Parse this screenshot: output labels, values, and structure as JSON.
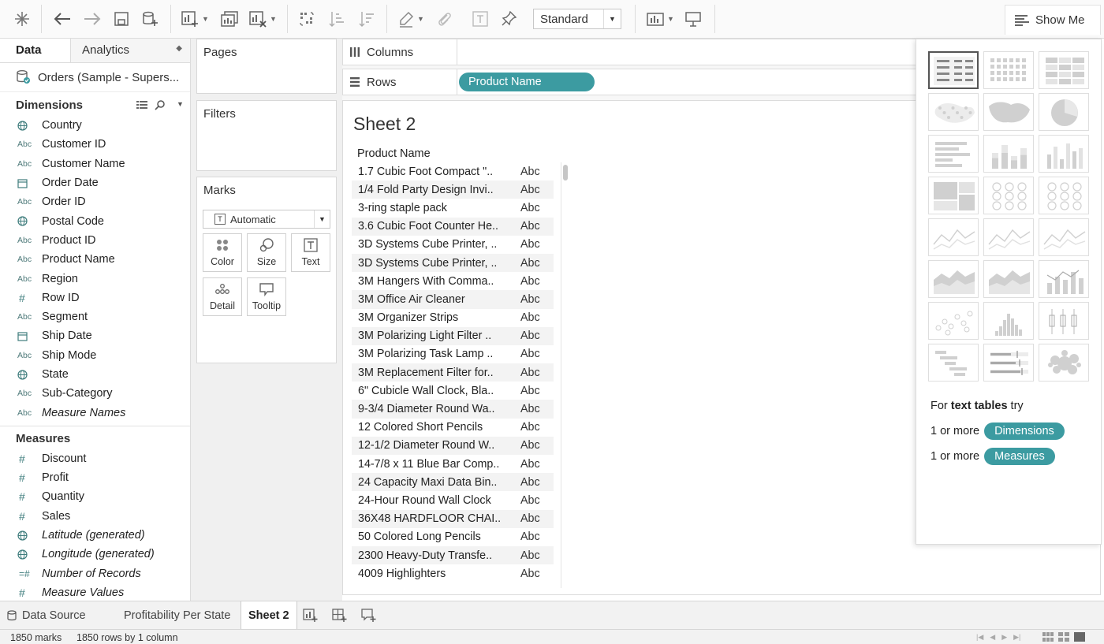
{
  "toolbar": {
    "fit_label": "Standard",
    "show_me_label": "Show Me"
  },
  "data_pane": {
    "tab_data": "Data",
    "tab_analytics": "Analytics",
    "datasource": "Orders (Sample - Supers...",
    "dimensions_header": "Dimensions",
    "dimensions": [
      {
        "icon": "globe",
        "name": "Country"
      },
      {
        "icon": "Abc",
        "name": "Customer ID"
      },
      {
        "icon": "Abc",
        "name": "Customer Name"
      },
      {
        "icon": "calendar",
        "name": "Order Date"
      },
      {
        "icon": "Abc",
        "name": "Order ID"
      },
      {
        "icon": "globe",
        "name": "Postal Code"
      },
      {
        "icon": "Abc",
        "name": "Product ID"
      },
      {
        "icon": "Abc",
        "name": "Product Name"
      },
      {
        "icon": "Abc",
        "name": "Region"
      },
      {
        "icon": "#",
        "name": "Row ID"
      },
      {
        "icon": "Abc",
        "name": "Segment"
      },
      {
        "icon": "calendar",
        "name": "Ship Date"
      },
      {
        "icon": "Abc",
        "name": "Ship Mode"
      },
      {
        "icon": "globe",
        "name": "State"
      },
      {
        "icon": "Abc",
        "name": "Sub-Category"
      },
      {
        "icon": "Abc",
        "name": "Measure Names"
      }
    ],
    "measures_header": "Measures",
    "measures": [
      {
        "icon": "#",
        "name": "Discount"
      },
      {
        "icon": "#",
        "name": "Profit"
      },
      {
        "icon": "#",
        "name": "Quantity"
      },
      {
        "icon": "#",
        "name": "Sales"
      },
      {
        "icon": "globe",
        "name": "Latitude (generated)"
      },
      {
        "icon": "globe",
        "name": "Longitude (generated)"
      },
      {
        "icon": "=#",
        "name": "Number of Records"
      },
      {
        "icon": "#",
        "name": "Measure Values"
      }
    ]
  },
  "cards": {
    "pages": "Pages",
    "filters": "Filters",
    "marks": "Marks",
    "marks_type": "Automatic",
    "buttons": [
      "Color",
      "Size",
      "Text",
      "Detail",
      "Tooltip"
    ]
  },
  "shelves": {
    "columns": "Columns",
    "rows": "Rows",
    "rows_pill": "Product Name"
  },
  "sheet": {
    "title": "Sheet 2",
    "column_header": "Product Name",
    "rows": [
      {
        "name": "1.7 Cubic Foot Compact \"..",
        "value": "Abc"
      },
      {
        "name": "1/4 Fold Party Design Invi..",
        "value": "Abc"
      },
      {
        "name": "3-ring staple pack",
        "value": "Abc"
      },
      {
        "name": "3.6 Cubic Foot Counter He..",
        "value": "Abc"
      },
      {
        "name": "3D Systems Cube Printer, ..",
        "value": "Abc"
      },
      {
        "name": "3D Systems Cube Printer, ..",
        "value": "Abc"
      },
      {
        "name": "3M Hangers With Comma..",
        "value": "Abc"
      },
      {
        "name": "3M Office Air Cleaner",
        "value": "Abc"
      },
      {
        "name": "3M Organizer Strips",
        "value": "Abc"
      },
      {
        "name": "3M Polarizing Light Filter ..",
        "value": "Abc"
      },
      {
        "name": "3M Polarizing Task Lamp ..",
        "value": "Abc"
      },
      {
        "name": "3M Replacement Filter for..",
        "value": "Abc"
      },
      {
        "name": "6\" Cubicle Wall Clock, Bla..",
        "value": "Abc"
      },
      {
        "name": "9-3/4 Diameter Round Wa..",
        "value": "Abc"
      },
      {
        "name": "12 Colored Short Pencils",
        "value": "Abc"
      },
      {
        "name": "12-1/2 Diameter Round W..",
        "value": "Abc"
      },
      {
        "name": "14-7/8 x 11 Blue Bar Comp..",
        "value": "Abc"
      },
      {
        "name": "24 Capacity Maxi Data Bin..",
        "value": "Abc"
      },
      {
        "name": "24-Hour Round Wall Clock",
        "value": "Abc"
      },
      {
        "name": "36X48 HARDFLOOR CHAI..",
        "value": "Abc"
      },
      {
        "name": "50 Colored Long Pencils",
        "value": "Abc"
      },
      {
        "name": "2300 Heavy-Duty Transfe..",
        "value": "Abc"
      },
      {
        "name": "4009 Highlighters",
        "value": "Abc"
      }
    ]
  },
  "show_me": {
    "hint_prefix": "For ",
    "hint_bold": "text tables",
    "hint_suffix": " try",
    "req1_prefix": "1 or more",
    "req1_pill": "Dimensions",
    "req2_prefix": "1 or more",
    "req2_pill": "Measures"
  },
  "sheet_tabs": {
    "data_source": "Data Source",
    "tab1": "Profitability Per State",
    "tab2": "Sheet 2"
  },
  "status": {
    "marks": "1850 marks",
    "rows": "1850 rows by 1 column"
  },
  "colors": {
    "accent": "#3c9ba1",
    "icon_teal": "#4e7a7a"
  }
}
